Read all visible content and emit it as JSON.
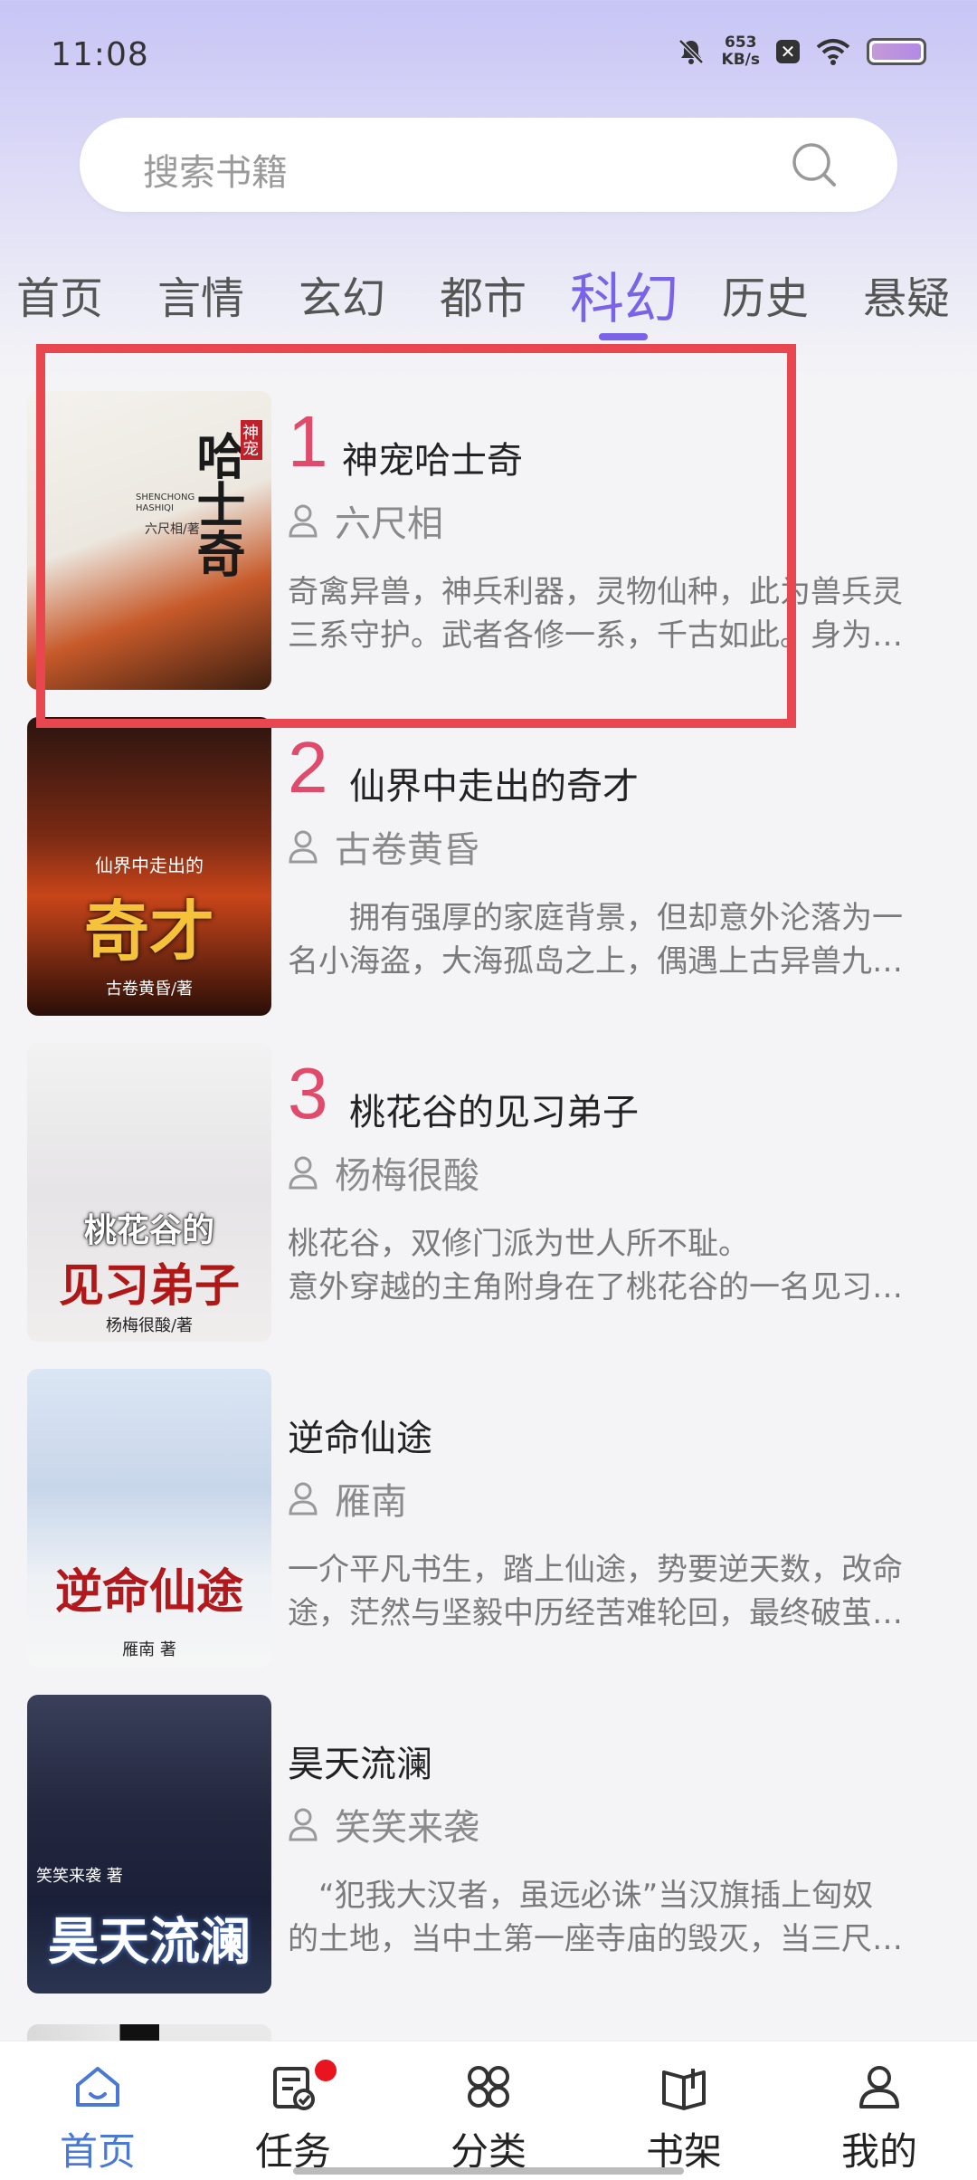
{
  "status_bar": {
    "time": "11:08",
    "net_speed_value": "653",
    "net_speed_unit": "KB/s"
  },
  "search": {
    "placeholder": "搜索书籍"
  },
  "tabs": [
    {
      "label": "首页"
    },
    {
      "label": "言情"
    },
    {
      "label": "玄幻"
    },
    {
      "label": "都市"
    },
    {
      "label": "科幻"
    },
    {
      "label": "历史"
    },
    {
      "label": "悬疑"
    }
  ],
  "active_tab": "科幻",
  "books": [
    {
      "rank": "1",
      "title": "神宠哈士奇",
      "author": "六尺相",
      "desc_line1": "奇禽异兽，神兵利器，灵物仙种，此为兽兵灵",
      "desc_line2": "三系守护。武者各修一系，千古如此。身为…",
      "cover_title": "哈士奇",
      "cover_subtitle": "神宠",
      "cover_pinyin": "SHENCHONG HASHIQI",
      "cover_author": "六尺相/著"
    },
    {
      "rank": "2",
      "title": "仙界中走出的奇才",
      "author": "古卷黄昏",
      "desc_line1": "　　拥有强厚的家庭背景，但却意外沦落为一",
      "desc_line2": "名小海盗，大海孤岛之上，偶遇上古异兽九…",
      "cover_title": "奇才",
      "cover_subtitle": "仙界中走出的",
      "cover_author": "古卷黄昏/著"
    },
    {
      "rank": "3",
      "title": "桃花谷的见习弟子",
      "author": "杨梅很酸",
      "desc_line1": "桃花谷，双修门派为世人所不耻。",
      "desc_line2": "意外穿越的主角附身在了桃花谷的一名见习…",
      "cover_title": "见习弟子",
      "cover_subtitle": "桃花谷的",
      "cover_author": "杨梅很酸/著"
    },
    {
      "rank": "",
      "title": "逆命仙途",
      "author": "雁南",
      "desc_line1": "一介平凡书生，踏上仙途，势要逆天数，改命",
      "desc_line2": "途，茫然与坚毅中历经苦难轮回，最终破茧…",
      "cover_title": "逆命仙途",
      "cover_author": "雁南 著"
    },
    {
      "rank": "",
      "title": "昊天流澜",
      "author": "笑笑来袭",
      "desc_line1": "　“犯我大汉者，虽远必诛”当汉旗插上匈奴",
      "desc_line2": "的土地，当中土第一座寺庙的毁灭，当三尺…",
      "cover_title": "昊天流澜",
      "cover_subtitle": "笑笑来袭 著"
    }
  ],
  "bottom_nav": [
    {
      "label": "首页",
      "icon": "home-icon"
    },
    {
      "label": "任务",
      "icon": "task-icon"
    },
    {
      "label": "分类",
      "icon": "category-icon"
    },
    {
      "label": "书架",
      "icon": "bookshelf-icon"
    },
    {
      "label": "我的",
      "icon": "profile-icon"
    }
  ],
  "colors": {
    "accent": "#7a63e8",
    "rank": "#e04a6b",
    "nav_active": "#4a78d6",
    "highlight": "#e8474f"
  }
}
